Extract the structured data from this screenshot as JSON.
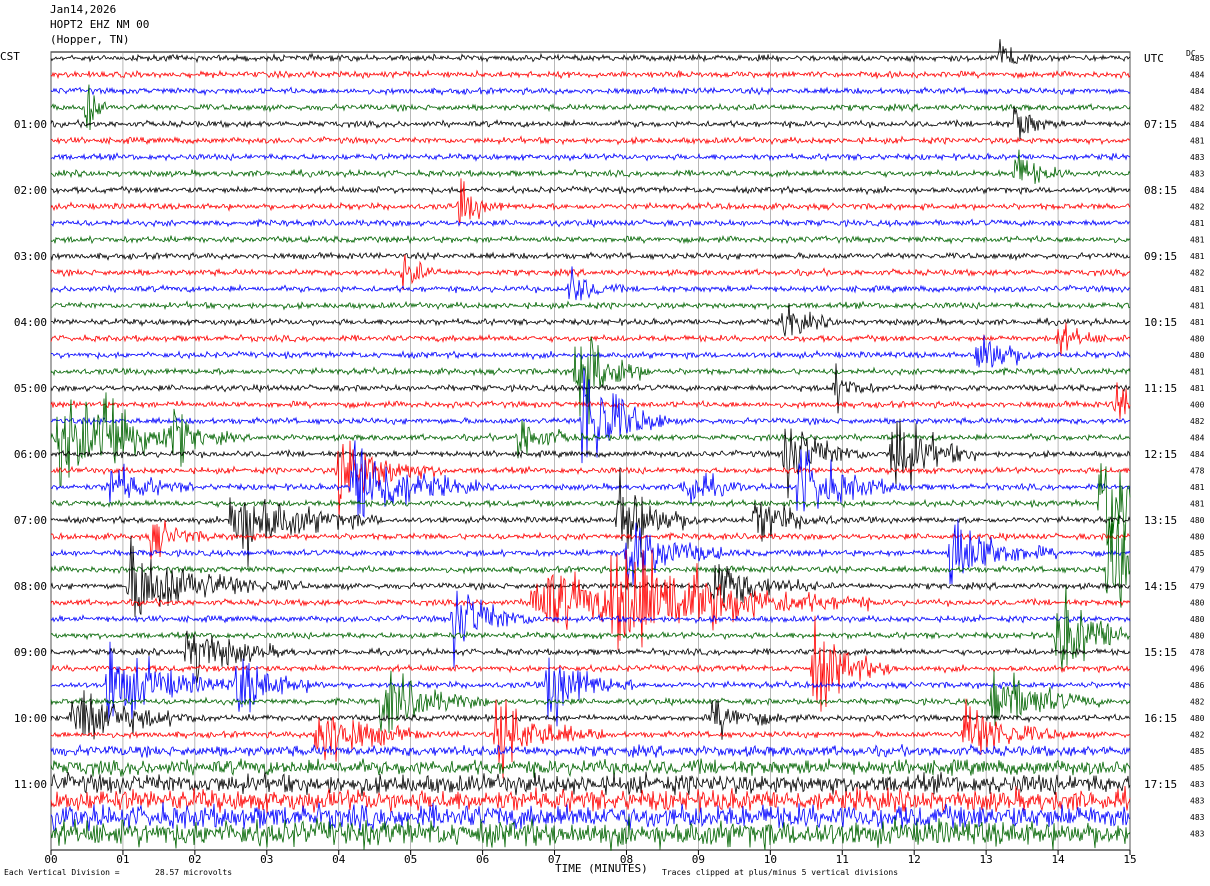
{
  "header": {
    "date": "Jan14,2026",
    "station": "HOPT2 EHZ NM 00",
    "location": "(Hopper, TN)"
  },
  "left_axis_title": "CST",
  "right_axis_title": "UTC",
  "dc_title": "DC",
  "chart_data": {
    "type": "line",
    "title": "",
    "xlabel": "TIME (MINUTES)",
    "xlim": [
      0,
      15
    ],
    "x_ticks": [
      "00",
      "01",
      "02",
      "03",
      "04",
      "05",
      "06",
      "07",
      "08",
      "09",
      "10",
      "11",
      "12",
      "13",
      "14",
      "15"
    ],
    "trace_minutes": 15,
    "trace_count": 48,
    "trace_colors": [
      "#000000",
      "#ff0000",
      "#0000ff",
      "#006400"
    ],
    "left_time_labels": [
      {
        "trace": 4,
        "label": "01:00"
      },
      {
        "trace": 8,
        "label": "02:00"
      },
      {
        "trace": 12,
        "label": "03:00"
      },
      {
        "trace": 16,
        "label": "04:00"
      },
      {
        "trace": 20,
        "label": "05:00"
      },
      {
        "trace": 24,
        "label": "06:00"
      },
      {
        "trace": 28,
        "label": "07:00"
      },
      {
        "trace": 32,
        "label": "08:00"
      },
      {
        "trace": 36,
        "label": "09:00"
      },
      {
        "trace": 40,
        "label": "10:00"
      },
      {
        "trace": 44,
        "label": "11:00"
      }
    ],
    "right_time_labels": [
      {
        "trace": 0,
        "label": "UTC"
      },
      {
        "trace": 4,
        "label": "07:15"
      },
      {
        "trace": 8,
        "label": "08:15"
      },
      {
        "trace": 12,
        "label": "09:15"
      },
      {
        "trace": 16,
        "label": "10:15"
      },
      {
        "trace": 20,
        "label": "11:15"
      },
      {
        "trace": 24,
        "label": "12:15"
      },
      {
        "trace": 28,
        "label": "13:15"
      },
      {
        "trace": 32,
        "label": "14:15"
      },
      {
        "trace": 36,
        "label": "15:15"
      },
      {
        "trace": 40,
        "label": "16:15"
      },
      {
        "trace": 44,
        "label": "17:15"
      }
    ],
    "dc_offsets": [
      485,
      484,
      484,
      482,
      484,
      481,
      483,
      483,
      484,
      482,
      481,
      481,
      481,
      482,
      481,
      481,
      481,
      480,
      480,
      481,
      481,
      400,
      482,
      484,
      484,
      478,
      481,
      481,
      480,
      480,
      485,
      479,
      479,
      480,
      480,
      480,
      478,
      496,
      486,
      482,
      480,
      482,
      485,
      485,
      483,
      483,
      483,
      483
    ],
    "scale_label": "Each Vertical Division =",
    "scale_value": "28.57 microvolts",
    "clip_note": "Traces clipped at plus/minus 5 vertical divisions",
    "events": [
      {
        "trace": 0,
        "min": 13.2,
        "amp": 1.2,
        "dur": 0.15
      },
      {
        "trace": 3,
        "min": 0.5,
        "amp": 1.8,
        "dur": 0.1
      },
      {
        "trace": 4,
        "min": 13.4,
        "amp": 1.2,
        "dur": 0.2
      },
      {
        "trace": 7,
        "min": 13.4,
        "amp": 1.1,
        "dur": 0.25
      },
      {
        "trace": 9,
        "min": 5.7,
        "amp": 1.2,
        "dur": 0.2
      },
      {
        "trace": 13,
        "min": 4.9,
        "amp": 0.9,
        "dur": 0.2
      },
      {
        "trace": 14,
        "min": 7.2,
        "amp": 1.0,
        "dur": 0.25
      },
      {
        "trace": 16,
        "min": 10.2,
        "amp": 1.0,
        "dur": 0.25
      },
      {
        "trace": 17,
        "min": 14.0,
        "amp": 0.8,
        "dur": 0.25
      },
      {
        "trace": 18,
        "min": 12.9,
        "amp": 1.6,
        "dur": 0.3
      },
      {
        "trace": 19,
        "min": 7.3,
        "amp": 3.0,
        "dur": 0.35
      },
      {
        "trace": 20,
        "min": 10.9,
        "amp": 1.0,
        "dur": 0.2
      },
      {
        "trace": 21,
        "min": 14.8,
        "amp": 1.0,
        "dur": 0.25
      },
      {
        "trace": 22,
        "min": 7.4,
        "amp": 3.5,
        "dur": 0.4
      },
      {
        "trace": 23,
        "min": 0.1,
        "amp": 2.5,
        "dur": 0.6
      },
      {
        "trace": 23,
        "min": 0.7,
        "amp": 2.0,
        "dur": 0.4
      },
      {
        "trace": 23,
        "min": 1.7,
        "amp": 1.2,
        "dur": 0.3
      },
      {
        "trace": 23,
        "min": 6.5,
        "amp": 1.2,
        "dur": 0.3
      },
      {
        "trace": 24,
        "min": 11.7,
        "amp": 2.5,
        "dur": 0.4
      },
      {
        "trace": 24,
        "min": 10.2,
        "amp": 2.0,
        "dur": 0.4
      },
      {
        "trace": 25,
        "min": 4.0,
        "amp": 2.0,
        "dur": 0.5
      },
      {
        "trace": 26,
        "min": 0.8,
        "amp": 1.2,
        "dur": 0.4
      },
      {
        "trace": 26,
        "min": 4.2,
        "amp": 2.5,
        "dur": 0.6
      },
      {
        "trace": 26,
        "min": 10.4,
        "amp": 2.0,
        "dur": 0.5
      },
      {
        "trace": 26,
        "min": 8.8,
        "amp": 1.2,
        "dur": 0.3
      },
      {
        "trace": 27,
        "min": 14.6,
        "amp": 3.0,
        "dur": 0.6
      },
      {
        "trace": 28,
        "min": 2.5,
        "amp": 2.2,
        "dur": 0.7
      },
      {
        "trace": 28,
        "min": 7.9,
        "amp": 2.5,
        "dur": 0.4
      },
      {
        "trace": 28,
        "min": 9.8,
        "amp": 1.2,
        "dur": 0.4
      },
      {
        "trace": 29,
        "min": 1.4,
        "amp": 1.0,
        "dur": 0.3
      },
      {
        "trace": 30,
        "min": 8.0,
        "amp": 2.0,
        "dur": 0.5
      },
      {
        "trace": 30,
        "min": 12.5,
        "amp": 2.0,
        "dur": 0.5
      },
      {
        "trace": 31,
        "min": 14.7,
        "amp": 3.5,
        "dur": 0.6
      },
      {
        "trace": 32,
        "min": 1.1,
        "amp": 2.0,
        "dur": 0.8
      },
      {
        "trace": 32,
        "min": 9.2,
        "amp": 1.5,
        "dur": 0.5
      },
      {
        "trace": 33,
        "min": 7.8,
        "amp": 3.0,
        "dur": 1.2
      },
      {
        "trace": 33,
        "min": 6.7,
        "amp": 1.8,
        "dur": 1.0
      },
      {
        "trace": 34,
        "min": 5.6,
        "amp": 2.0,
        "dur": 0.4
      },
      {
        "trace": 35,
        "min": 14.0,
        "amp": 2.2,
        "dur": 0.5
      },
      {
        "trace": 36,
        "min": 1.9,
        "amp": 1.6,
        "dur": 0.5
      },
      {
        "trace": 37,
        "min": 10.6,
        "amp": 2.2,
        "dur": 0.4
      },
      {
        "trace": 38,
        "min": 0.8,
        "amp": 2.2,
        "dur": 0.6
      },
      {
        "trace": 38,
        "min": 6.9,
        "amp": 2.0,
        "dur": 0.4
      },
      {
        "trace": 38,
        "min": 2.6,
        "amp": 1.6,
        "dur": 0.4
      },
      {
        "trace": 39,
        "min": 4.6,
        "amp": 1.8,
        "dur": 0.5
      },
      {
        "trace": 39,
        "min": 13.1,
        "amp": 2.0,
        "dur": 0.5
      },
      {
        "trace": 40,
        "min": 0.3,
        "amp": 1.8,
        "dur": 0.6
      },
      {
        "trace": 40,
        "min": 9.2,
        "amp": 1.0,
        "dur": 0.4
      },
      {
        "trace": 41,
        "min": 3.7,
        "amp": 2.0,
        "dur": 0.5
      },
      {
        "trace": 41,
        "min": 6.2,
        "amp": 1.8,
        "dur": 0.5
      },
      {
        "trace": 41,
        "min": 12.7,
        "amp": 1.6,
        "dur": 0.5
      }
    ]
  }
}
